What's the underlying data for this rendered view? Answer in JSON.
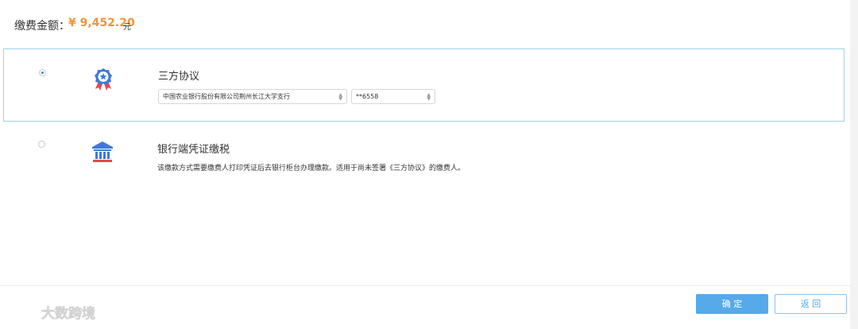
{
  "payment": {
    "label": "缴费金额：",
    "amount": "¥ 9,452.20",
    "unit": "元"
  },
  "options": [
    {
      "title": "三方协议",
      "selected": true,
      "icon": "award-ribbon-icon",
      "bank_select": "中国农业银行股份有限公司荆州长江大学支行",
      "account_select": "**6558"
    },
    {
      "title": "银行端凭证缴税",
      "selected": false,
      "icon": "bank-building-icon",
      "description": "该缴款方式需要缴费人打印凭证后去银行柜台办理缴款。适用于尚未签署《三方协议》的缴费人。"
    }
  ],
  "buttons": {
    "confirm": "确 定",
    "back": "返 回"
  },
  "watermark": {
    "text": "大数跨境"
  },
  "colors": {
    "accent": "#56aaea",
    "amount": "#f0953a",
    "selected_border": "#9fd0ee",
    "icon_blue": "#3b7ad9",
    "icon_red": "#e5484d"
  }
}
